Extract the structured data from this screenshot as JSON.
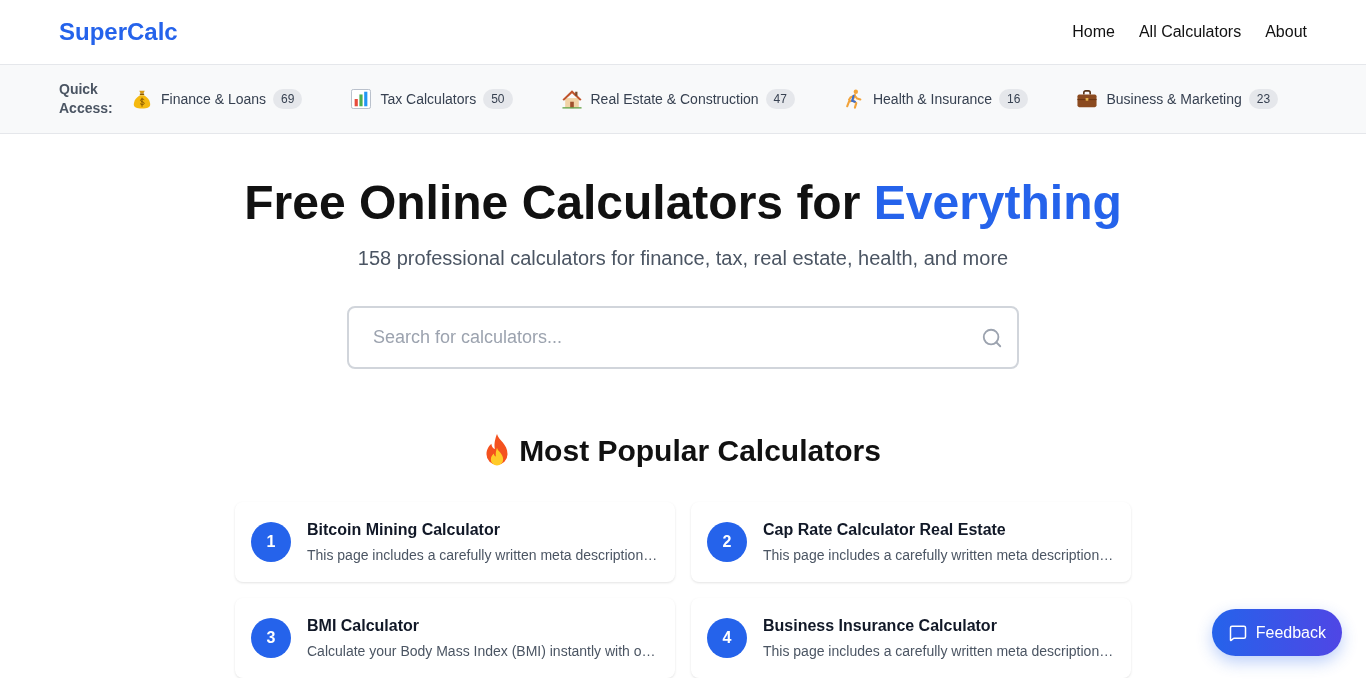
{
  "header": {
    "logo": "SuperCalc",
    "nav": [
      {
        "label": "Home"
      },
      {
        "label": "All Calculators"
      },
      {
        "label": "About"
      }
    ]
  },
  "quick_access": {
    "label": "Quick Access:",
    "categories": [
      {
        "label": "Finance & Loans",
        "count": "69"
      },
      {
        "label": "Tax Calculators",
        "count": "50"
      },
      {
        "label": "Real Estate & Construction",
        "count": "47"
      },
      {
        "label": "Health & Insurance",
        "count": "16"
      },
      {
        "label": "Business & Marketing",
        "count": "23"
      }
    ]
  },
  "hero": {
    "title": "Free Online Calculators for",
    "title_highlight": "Everything",
    "subtitle": "158 professional calculators for finance, tax, real estate, health, and more",
    "search": {
      "placeholder": "Search for calculators..."
    }
  },
  "popular": {
    "title": "Most Popular Calculators",
    "items": [
      {
        "rank": "1",
        "title": "Bitcoin Mining Calculator",
        "description": "This page includes a carefully written meta description…"
      },
      {
        "rank": "2",
        "title": "Cap Rate Calculator Real Estate",
        "description": "This page includes a carefully written meta description…"
      },
      {
        "rank": "3",
        "title": "BMI Calculator",
        "description": "Calculate your Body Mass Index (BMI) instantly with o…"
      },
      {
        "rank": "4",
        "title": "Business Insurance Calculator",
        "description": "This page includes a carefully written meta description…"
      }
    ]
  },
  "feedback": {
    "label": "Feedback"
  }
}
